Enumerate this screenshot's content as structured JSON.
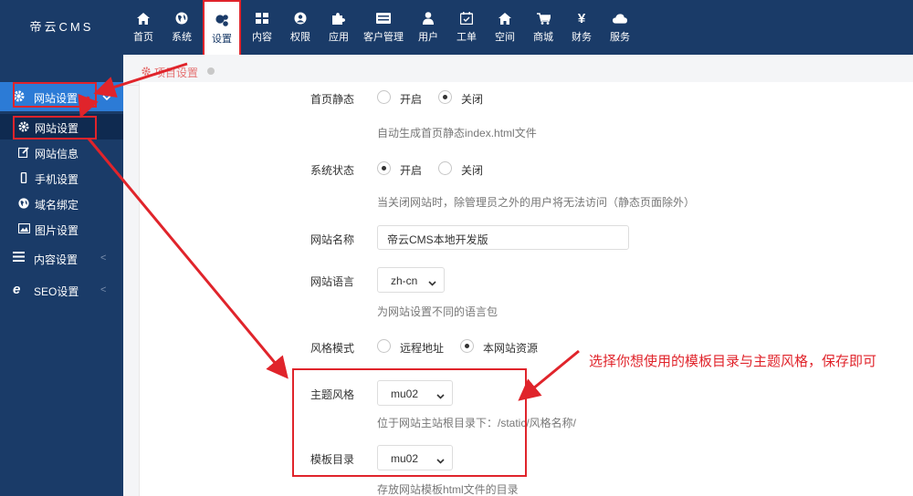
{
  "app": {
    "logo": "帝云CMS"
  },
  "topnav": [
    {
      "label": "首页",
      "icon": "home-icon"
    },
    {
      "label": "系统",
      "icon": "globe-icon"
    },
    {
      "label": "设置",
      "icon": "gears-icon",
      "active": true
    },
    {
      "label": "内容",
      "icon": "grid-icon"
    },
    {
      "label": "权限",
      "icon": "user-circle-icon"
    },
    {
      "label": "应用",
      "icon": "puzzle-icon"
    },
    {
      "label": "客户管理",
      "icon": "list-icon"
    },
    {
      "label": "用户",
      "icon": "user-icon"
    },
    {
      "label": "工单",
      "icon": "calendar-icon"
    },
    {
      "label": "空间",
      "icon": "home-icon"
    },
    {
      "label": "商城",
      "icon": "cart-icon"
    },
    {
      "label": "财务",
      "icon": "yen-icon"
    },
    {
      "label": "服务",
      "icon": "cloud-icon"
    }
  ],
  "sidebar": {
    "group_title": "网站设置",
    "items": [
      {
        "label": "网站设置",
        "icon": "gear-icon",
        "active": true
      },
      {
        "label": "网站信息",
        "icon": "edit-icon"
      },
      {
        "label": "手机设置",
        "icon": "mobile-icon"
      },
      {
        "label": "域名绑定",
        "icon": "globe-icon"
      },
      {
        "label": "图片设置",
        "icon": "image-icon"
      }
    ],
    "groups": [
      {
        "label": "内容设置",
        "icon": "bars-icon"
      },
      {
        "label": "SEO设置",
        "icon": "ie-icon"
      }
    ]
  },
  "breadcrumb": {
    "label": "项目设置"
  },
  "form": {
    "homepage_static": {
      "label": "首页静态",
      "opt_on": "开启",
      "opt_off": "关闭",
      "selected": "关闭",
      "help": "自动生成首页静态index.html文件"
    },
    "site_status": {
      "label": "系统状态",
      "opt_on": "开启",
      "opt_off": "关闭",
      "selected": "开启",
      "help": "当关闭网站时，除管理员之外的用户将无法访问（静态页面除外）"
    },
    "site_name": {
      "label": "网站名称",
      "value": "帝云CMS本地开发版"
    },
    "site_language": {
      "label": "网站语言",
      "value": "zh-cn",
      "help": "为网站设置不同的语言包"
    },
    "style_mode": {
      "label": "风格模式",
      "opt_remote": "远程地址",
      "opt_local": "本网站资源",
      "selected": "本网站资源"
    },
    "theme_style": {
      "label": "主题风格",
      "value": "mu02",
      "help": "位于网站主站根目录下：/static/风格名称/"
    },
    "template_dir": {
      "label": "模板目录",
      "value": "mu02",
      "help": "存放网站模板html文件的目录"
    }
  },
  "annotation": {
    "note": "选择你想使用的模板目录与主题风格，保存即可",
    "color": "#e0242b"
  },
  "colors": {
    "header": "#1a3b68",
    "sidebar_active": "#2c7bd6",
    "accent_red": "#e0242b"
  }
}
